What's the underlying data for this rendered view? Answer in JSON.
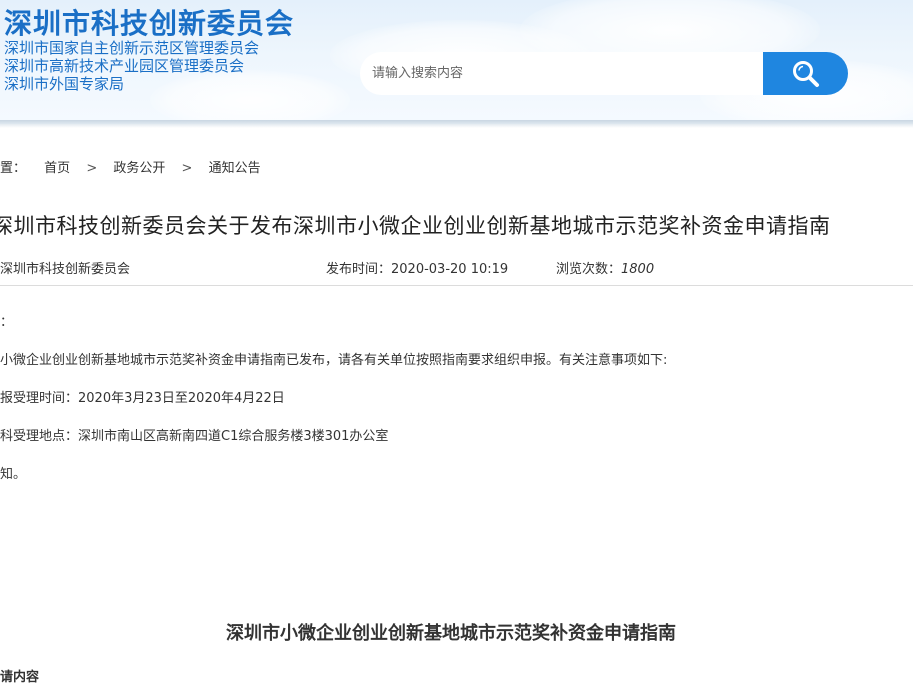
{
  "header": {
    "site_title": "深圳市科技创新委员会",
    "sub_orgs": [
      "深圳市国家自主创新示范区管理委员会",
      "深圳市高新技术产业园区管理委员会",
      "深圳市外国专家局"
    ]
  },
  "search": {
    "placeholder": "请输入搜索内容",
    "button_icon": "search-icon"
  },
  "breadcrumb": {
    "prefix": "置：",
    "items": [
      "首页",
      "政务公开",
      "通知公告"
    ],
    "separator": ">"
  },
  "article": {
    "title": "深圳市科技创新委员会关于发布深圳市小微企业创业创新基地城市示范奖补资金申请指南",
    "source": "深圳市科技创新委员会",
    "publish_label": "发布时间：",
    "publish_time": "2020-03-20 10:19",
    "views_label": "浏览次数：",
    "views": "1800",
    "body": [
      "：",
      "小微企业创业创新基地城市示范奖补资金申请指南已发布，请各有关单位按照指南要求组织申报。有关注意事项如下:",
      "报受理时间：2020年3月23日至2020年4月22日",
      "科受理地点：深圳市南山区高新南四道C1综合服务楼3楼301办公室",
      "知。"
    ],
    "guide_title": "深圳市小微企业创业创新基地城市示范奖补资金申请指南",
    "partial_heading": "请内容"
  },
  "colors": {
    "brand_blue": "#1a6fc6",
    "search_button": "#1f86e0"
  }
}
